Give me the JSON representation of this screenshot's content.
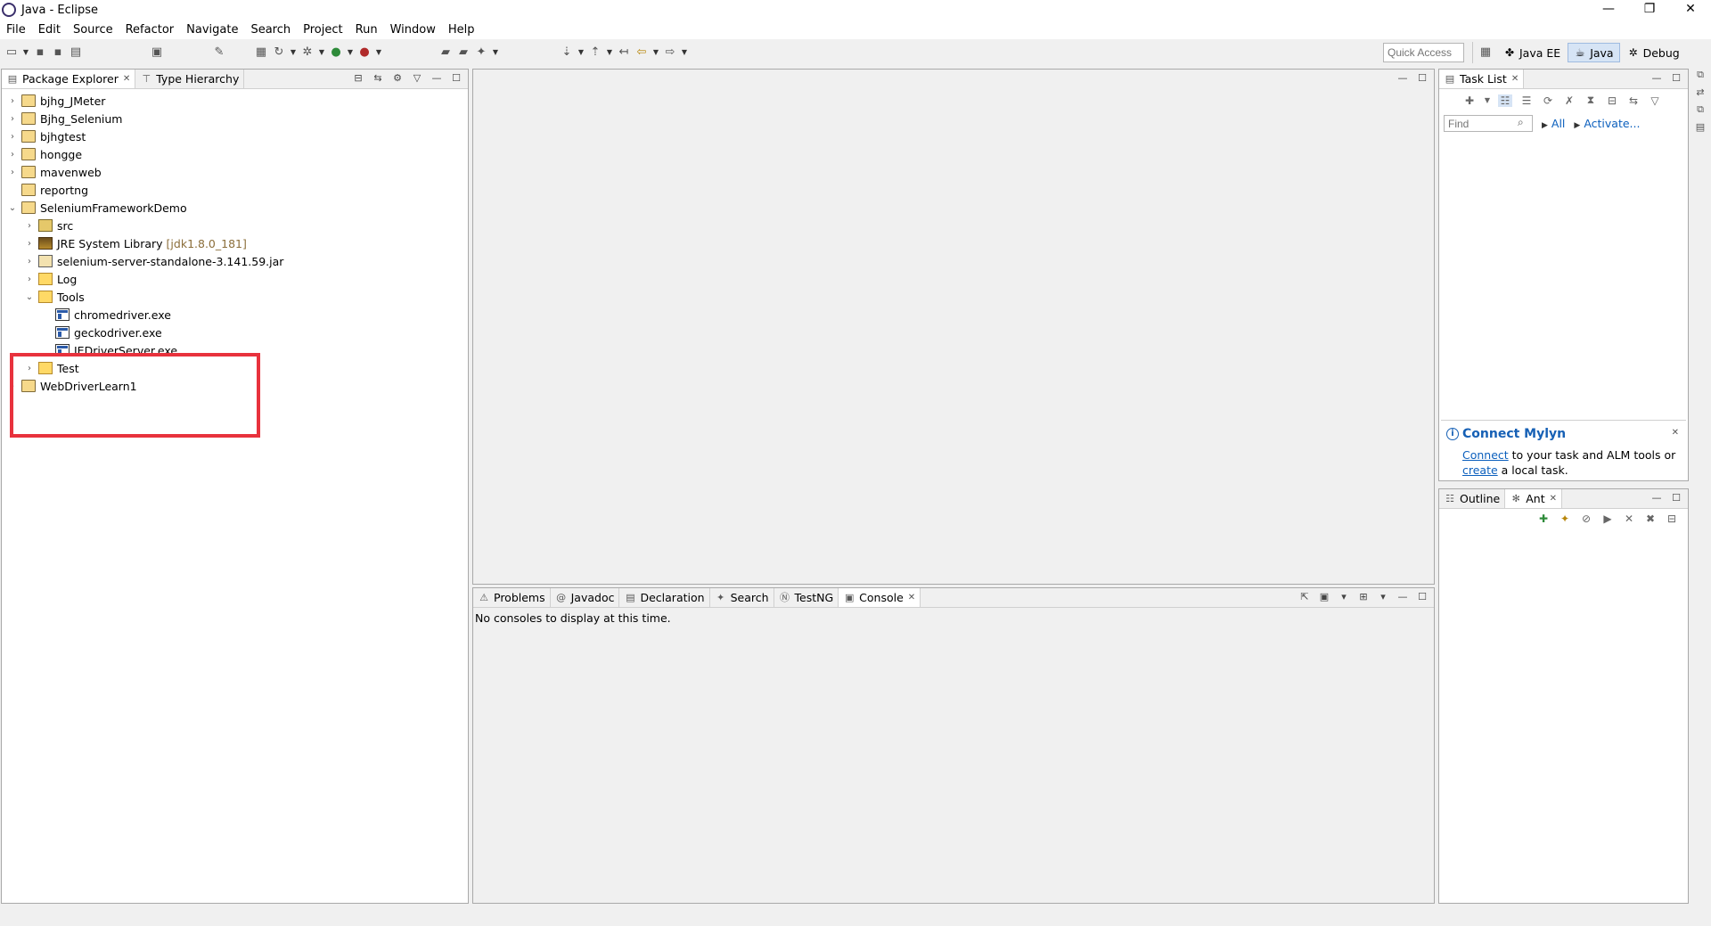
{
  "window": {
    "title": "Java - Eclipse",
    "controls": [
      "—",
      "❐",
      "✕"
    ]
  },
  "menu": [
    "File",
    "Edit",
    "Source",
    "Refactor",
    "Navigate",
    "Search",
    "Project",
    "Run",
    "Window",
    "Help"
  ],
  "quick_access": {
    "placeholder": "Quick Access"
  },
  "perspectives": [
    {
      "label": "Java EE",
      "icon": "javaee-icon",
      "active": false
    },
    {
      "label": "Java",
      "icon": "java-icon",
      "active": true
    },
    {
      "label": "Debug",
      "icon": "debug-icon",
      "active": false
    }
  ],
  "package_explorer": {
    "tabs": [
      "Package Explorer",
      "Type Hierarchy"
    ],
    "items": [
      {
        "label": "bjhg_JMeter",
        "depth": 0,
        "twisty": "›",
        "icon": "project"
      },
      {
        "label": "Bjhg_Selenium",
        "depth": 0,
        "twisty": "›",
        "icon": "project"
      },
      {
        "label": "bjhgtest",
        "depth": 0,
        "twisty": "›",
        "icon": "project"
      },
      {
        "label": "hongge",
        "depth": 0,
        "twisty": "›",
        "icon": "project"
      },
      {
        "label": "mavenweb",
        "depth": 0,
        "twisty": "›",
        "icon": "project"
      },
      {
        "label": "reportng",
        "depth": 0,
        "twisty": "",
        "icon": "project"
      },
      {
        "label": "SeleniumFrameworkDemo",
        "depth": 0,
        "twisty": "⌄",
        "icon": "project"
      },
      {
        "label": "src",
        "depth": 1,
        "twisty": "›",
        "icon": "pkg"
      },
      {
        "label": "JRE System Library",
        "decor": "[jdk1.8.0_181]",
        "depth": 1,
        "twisty": "›",
        "icon": "lib"
      },
      {
        "label": "selenium-server-standalone-3.141.59.jar",
        "depth": 1,
        "twisty": "›",
        "icon": "jar"
      },
      {
        "label": "Log",
        "depth": 1,
        "twisty": "›",
        "icon": "folder"
      },
      {
        "label": "Tools",
        "depth": 1,
        "twisty": "⌄",
        "icon": "folder"
      },
      {
        "label": "chromedriver.exe",
        "depth": 2,
        "twisty": "",
        "icon": "exe"
      },
      {
        "label": "geckodriver.exe",
        "depth": 2,
        "twisty": "",
        "icon": "exe"
      },
      {
        "label": "IEDriverServer.exe",
        "depth": 2,
        "twisty": "",
        "icon": "exe"
      },
      {
        "label": "Test",
        "depth": 1,
        "twisty": "›",
        "icon": "folder"
      },
      {
        "label": "WebDriverLearn1",
        "depth": 0,
        "twisty": "›",
        "icon": "project"
      }
    ]
  },
  "bottom_panel": {
    "tabs": [
      {
        "label": "Problems",
        "icon": "problems-icon"
      },
      {
        "label": "Javadoc",
        "icon": "javadoc-icon"
      },
      {
        "label": "Declaration",
        "icon": "declaration-icon"
      },
      {
        "label": "Search",
        "icon": "search-icon"
      },
      {
        "label": "TestNG",
        "icon": "testng-icon"
      },
      {
        "label": "Console",
        "icon": "console-icon",
        "active": true
      }
    ],
    "console_message": "No consoles to display at this time."
  },
  "task_list": {
    "tab": "Task List",
    "find_placeholder": "Find",
    "filter_all": "All",
    "activate": "Activate...",
    "mylyn_title": "Connect Mylyn",
    "mylyn_link1": "Connect",
    "mylyn_text1": " to your task and ALM tools or",
    "mylyn_link2": "create",
    "mylyn_text2": " a local task."
  },
  "outline_panel": {
    "tabs": [
      "Outline",
      "Ant"
    ]
  },
  "colors": {
    "highlight": "#e8323d",
    "link": "#0b5fbd"
  }
}
